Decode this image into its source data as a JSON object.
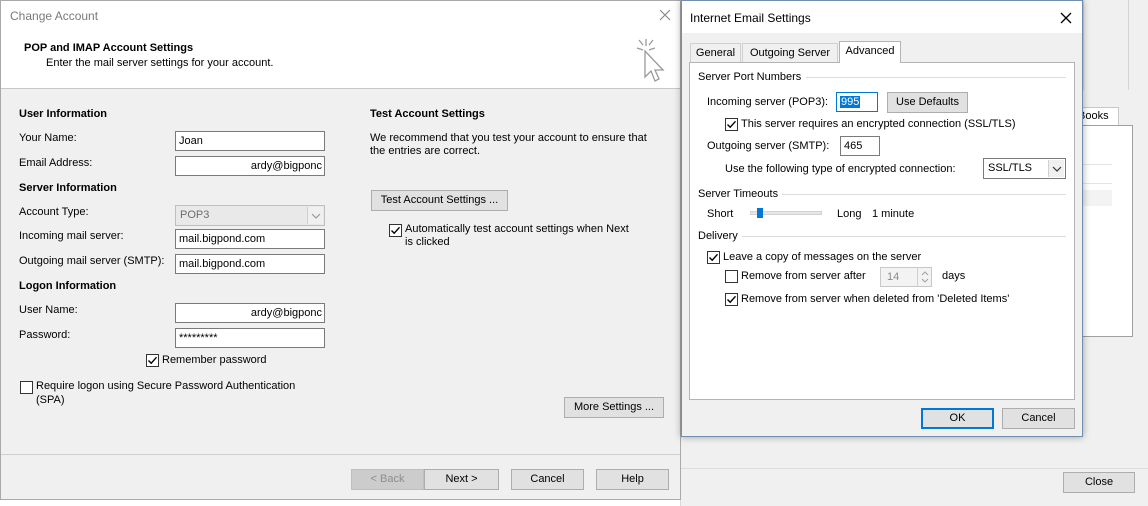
{
  "background_window": {
    "tab_fragment": "Books",
    "close_label": "Close"
  },
  "change_account": {
    "title": "Change Account",
    "header": {
      "title": "POP and IMAP Account Settings",
      "subtitle": "Enter the mail server settings for your account."
    },
    "user_info": {
      "section": "User Information",
      "your_name_label": "Your Name:",
      "your_name_value": "Joan",
      "email_label": "Email Address:",
      "email_value": "ardy@bigponc"
    },
    "server_info": {
      "section": "Server Information",
      "account_type_label": "Account Type:",
      "account_type_value": "POP3",
      "incoming_label": "Incoming mail server:",
      "incoming_value": "mail.bigpond.com",
      "outgoing_label": "Outgoing mail server (SMTP):",
      "outgoing_value": "mail.bigpond.com"
    },
    "logon_info": {
      "section": "Logon Information",
      "username_label": "User Name:",
      "username_value": "ardy@bigponc",
      "password_label": "Password:",
      "password_value": "*********",
      "remember_label": "Remember password",
      "remember_checked": true,
      "spa_label_line1": "Require logon using Secure Password Authentication",
      "spa_label_line2": "(SPA)",
      "spa_checked": false
    },
    "test_settings": {
      "section": "Test Account Settings",
      "description_line1": "We recommend that you test your account to ensure that",
      "description_line2": "the entries are correct.",
      "test_button": "Test Account Settings ...",
      "auto_test_line1": "Automatically test account settings when Next",
      "auto_test_line2": "is clicked",
      "auto_test_checked": true
    },
    "more_settings_button": "More Settings ...",
    "buttons": {
      "back": "< Back",
      "next": "Next >",
      "cancel": "Cancel",
      "help": "Help"
    }
  },
  "internet_email_settings": {
    "title": "Internet Email Settings",
    "tabs": [
      {
        "label": "General",
        "active": false
      },
      {
        "label": "Outgoing Server",
        "active": false
      },
      {
        "label": "Advanced",
        "active": true
      }
    ],
    "ports": {
      "section": "Server Port Numbers",
      "incoming_label": "Incoming server (POP3):",
      "incoming_value": "995",
      "use_defaults_button": "Use Defaults",
      "ssl_label": "This server requires an encrypted connection (SSL/TLS)",
      "ssl_checked": true,
      "outgoing_label": "Outgoing server (SMTP):",
      "outgoing_value": "465",
      "encryption_label": "Use the following type of encrypted connection:",
      "encryption_value": "SSL/TLS"
    },
    "timeouts": {
      "section": "Server Timeouts",
      "short_label": "Short",
      "long_label": "Long",
      "value_label": "1 minute",
      "slider_fraction": 0.1
    },
    "delivery": {
      "section": "Delivery",
      "leave_copy_label": "Leave a copy of messages on the server",
      "leave_copy_checked": true,
      "remove_after_label": "Remove from server after",
      "remove_after_checked": false,
      "remove_after_days": "14",
      "days_label": "days",
      "remove_deleted_label": "Remove from server when deleted from 'Deleted Items'",
      "remove_deleted_checked": true
    },
    "buttons": {
      "ok": "OK",
      "cancel": "Cancel"
    }
  },
  "colors": {
    "accent": "#0078d7",
    "window_bg": "#f0f0f0",
    "title_text_inactive": "#7a7a7a"
  }
}
